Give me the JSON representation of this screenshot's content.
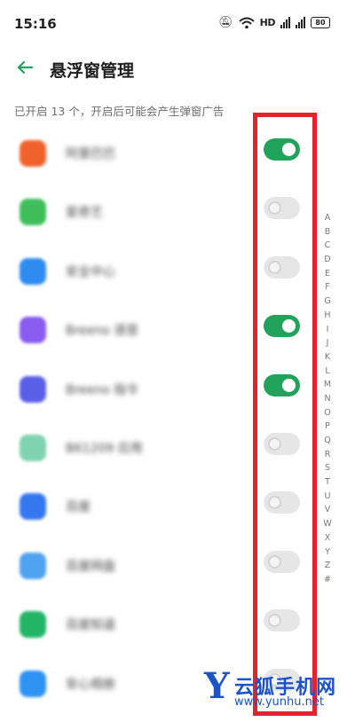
{
  "status_bar": {
    "time": "15:16",
    "hd_label": "HD",
    "battery": "80"
  },
  "header": {
    "back_icon": "arrow-left-icon",
    "title": "悬浮窗管理",
    "accent_color": "#21a35c"
  },
  "subtitle": "已开启 13 个，开启后可能会产生弹窗广告",
  "apps": [
    {
      "name": "阿里巴巴",
      "icon_color": "#f0622c",
      "enabled": true
    },
    {
      "name": "爱奇艺",
      "icon_color": "#3fbf5c",
      "enabled": false
    },
    {
      "name": "安全中心",
      "icon_color": "#2f8bf0",
      "enabled": false
    },
    {
      "name": "Breeno 语音",
      "icon_color": "#8a5cf0",
      "enabled": true
    },
    {
      "name": "Breeno 指令",
      "icon_color": "#5a5fe8",
      "enabled": true
    },
    {
      "name": "B61209 应用",
      "icon_color": "#7fd3b0",
      "enabled": false
    },
    {
      "name": "百度",
      "icon_color": "#3577ef",
      "enabled": false
    },
    {
      "name": "百度网盘",
      "icon_color": "#4fa3f0",
      "enabled": false
    },
    {
      "name": "百度知道",
      "icon_color": "#22b566",
      "enabled": false
    },
    {
      "name": "安心相册",
      "icon_color": "#2e93f2",
      "enabled": false
    }
  ],
  "alphabet_index": [
    "A",
    "B",
    "C",
    "D",
    "E",
    "F",
    "G",
    "H",
    "I",
    "J",
    "K",
    "L",
    "M",
    "N",
    "O",
    "P",
    "Q",
    "R",
    "S",
    "T",
    "U",
    "V",
    "W",
    "X",
    "Y",
    "Z",
    "#"
  ],
  "highlight_color": "#e0262b",
  "watermark": {
    "letter": "Y",
    "text": "云狐手机网",
    "url": "www.yunhu.net"
  }
}
